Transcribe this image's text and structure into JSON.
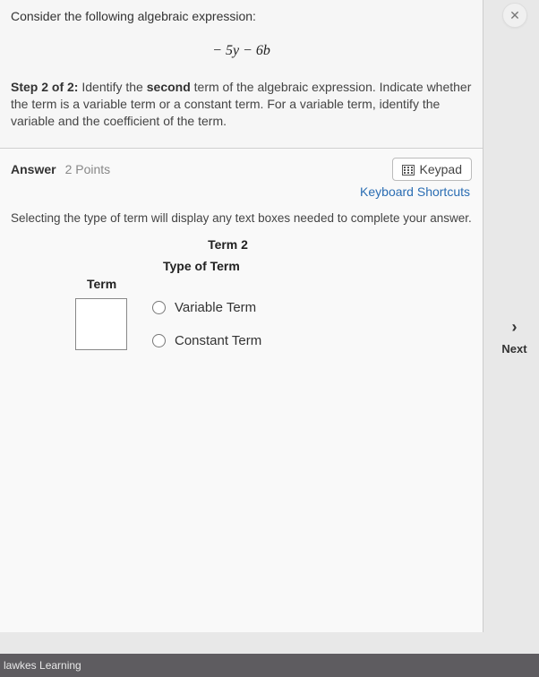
{
  "close_symbol": "✕",
  "question": {
    "intro": "Consider the following algebraic expression:",
    "expression": "− 5y − 6b",
    "step_label": "Step 2 of 2:",
    "step_text_pre": " Identify the ",
    "step_bold": "second",
    "step_text_post": " term of the algebraic expression. Indicate whether the term is a variable term or a constant term. For a variable term, identify the variable and the coefficient of the term."
  },
  "answer_bar": {
    "label": "Answer",
    "points": "2 Points",
    "keypad": "Keypad",
    "shortcuts": "Keyboard Shortcuts"
  },
  "helper": "Selecting the type of term will display any text boxes needed to complete your answer.",
  "term": {
    "heading": "Term 2",
    "type_heading": "Type of Term",
    "term_heading": "Term",
    "input_value": "",
    "option_variable": "Variable Term",
    "option_constant": "Constant Term"
  },
  "next": {
    "chevron": "›",
    "label": "Next"
  },
  "footer": "lawkes Learning"
}
